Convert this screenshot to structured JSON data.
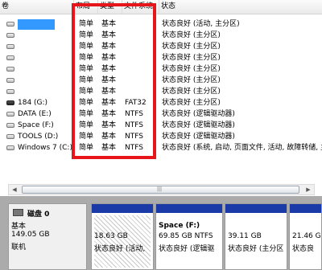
{
  "columns": [
    "卷",
    "布局",
    "类型",
    "文件系统",
    "状态"
  ],
  "volumes": [
    {
      "name": "",
      "layout": "简单",
      "type": "基本",
      "fs": "",
      "status": "状态良好 (活动, 主分区)"
    },
    {
      "name": "",
      "layout": "简单",
      "type": "基本",
      "fs": "",
      "status": "状态良好 (主分区)"
    },
    {
      "name": "",
      "layout": "简单",
      "type": "基本",
      "fs": "",
      "status": "状态良好 (主分区)"
    },
    {
      "name": "",
      "layout": "简单",
      "type": "基本",
      "fs": "",
      "status": "状态良好 (主分区)"
    },
    {
      "name": "",
      "layout": "简单",
      "type": "基本",
      "fs": "",
      "status": "状态良好 (主分区)"
    },
    {
      "name": "",
      "layout": "简单",
      "type": "基本",
      "fs": "",
      "status": "状态良好 (主分区)"
    },
    {
      "name": "",
      "layout": "简单",
      "type": "基本",
      "fs": "",
      "status": "状态良好 (主分区)"
    },
    {
      "name": "184 (G:)",
      "layout": "简单",
      "type": "基本",
      "fs": "FAT32",
      "status": "状态良好 (主分区)"
    },
    {
      "name": "DATA (E:)",
      "layout": "简单",
      "type": "基本",
      "fs": "NTFS",
      "status": "状态良好 (逻辑驱动器)"
    },
    {
      "name": "Space (F:)",
      "layout": "简单",
      "type": "基本",
      "fs": "NTFS",
      "status": "状态良好 (逻辑驱动器)"
    },
    {
      "name": "TOOLS (D:)",
      "layout": "简单",
      "type": "基本",
      "fs": "NTFS",
      "status": "状态良好 (逻辑驱动器)"
    },
    {
      "name": "Windows 7 (C:)",
      "layout": "简单",
      "type": "基本",
      "fs": "NTFS",
      "status": "状态良好 (系统, 启动, 页面文件, 活动, 故障转储, 主"
    }
  ],
  "disk": {
    "label": "磁盘 0",
    "type": "基本",
    "size": "149.05 GB",
    "state": "联机"
  },
  "partitions": [
    {
      "name": "",
      "size": "18.63 GB",
      "status": "状态良好 (活动,"
    },
    {
      "name": "Space (F:)",
      "size": "69.85 GB NTFS",
      "status": "状态良好 (逻辑驱"
    },
    {
      "name": "",
      "size": "39.11 GB",
      "status": "状态良好 (主分区"
    },
    {
      "name": "",
      "size": "21.46 G",
      "status": "状态良"
    }
  ],
  "colors": {
    "highlight": "#e8141b",
    "selection": "#3399ff",
    "partition_bar": "#1a3aa8"
  }
}
